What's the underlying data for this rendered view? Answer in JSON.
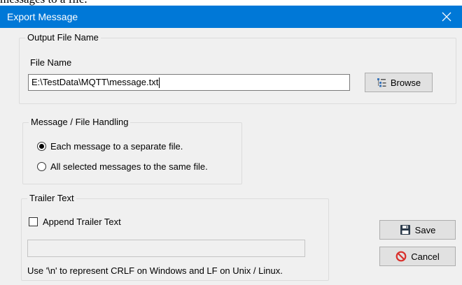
{
  "background_text": "messages to a file.",
  "window": {
    "title": "Export Message",
    "close_glyph": "✕",
    "titlebar_color": "#0078d7"
  },
  "output_file": {
    "group_label": "Output File Name",
    "field_label": "File Name",
    "value": "E:\\TestData\\MQTT\\message.txt",
    "browse_label": "Browse",
    "browse_icon": "tree-list-icon"
  },
  "handling": {
    "group_label": "Message / File Handling",
    "options": [
      {
        "label": "Each message to a separate file.",
        "selected": true
      },
      {
        "label": "All selected messages to the same file.",
        "selected": false
      }
    ]
  },
  "trailer": {
    "group_label": "Trailer Text",
    "checkbox_label": "Append Trailer Text",
    "checked": false,
    "text_value": "",
    "hint": "Use '\\n' to represent CRLF on Windows and LF on Unix / Linux."
  },
  "actions": {
    "save_label": "Save",
    "save_icon": "floppy-disk-icon",
    "cancel_label": "Cancel",
    "cancel_icon": "no-entry-icon",
    "cancel_icon_color": "#d9302c"
  }
}
